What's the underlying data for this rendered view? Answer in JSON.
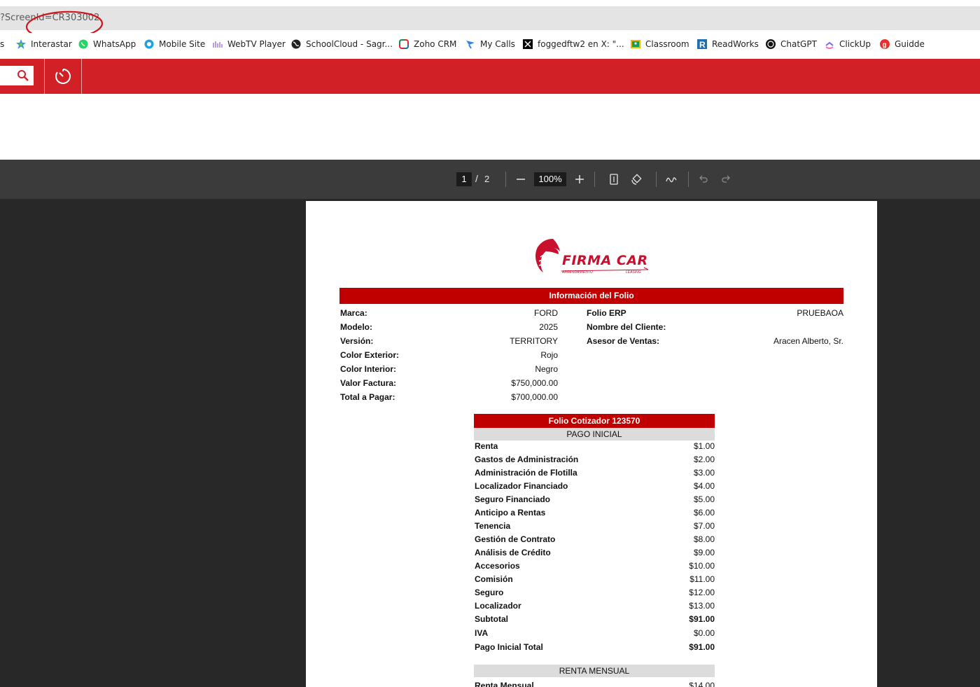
{
  "browser": {
    "address_text": "?ScreenId=CR303002",
    "bookmarks": [
      {
        "label": "s",
        "icon": "bookmark-icon"
      },
      {
        "label": "Interastar",
        "icon": "star-icon"
      },
      {
        "label": "WhatsApp",
        "icon": "whatsapp-icon"
      },
      {
        "label": "Mobile Site",
        "icon": "mobile-site-icon"
      },
      {
        "label": "WebTV Player",
        "icon": "webtv-icon"
      },
      {
        "label": "SchoolCloud - Sagr...",
        "icon": "globe-icon"
      },
      {
        "label": "Zoho CRM",
        "icon": "zoho-icon"
      },
      {
        "label": "My Calls",
        "icon": "calls-icon"
      },
      {
        "label": "foggedftw2 en X: \"...",
        "icon": "x-icon"
      },
      {
        "label": "Classroom",
        "icon": "classroom-icon"
      },
      {
        "label": "ReadWorks",
        "icon": "readworks-icon"
      },
      {
        "label": "ChatGPT",
        "icon": "chatgpt-icon"
      },
      {
        "label": "ClickUp",
        "icon": "clickup-icon"
      },
      {
        "label": "Guidde",
        "icon": "guidde-icon"
      }
    ]
  },
  "app_header": {
    "color": "#d22027",
    "search_icon": "search-icon",
    "timer_icon": "timer-icon"
  },
  "viewer": {
    "current_page": "1",
    "separator": "/",
    "total_pages": "2",
    "zoom": "100%"
  },
  "document": {
    "logo": {
      "name": "FIRMA CAR",
      "sub_left": "ARRENDAMIENTO",
      "sub_right": "LEASING"
    },
    "info_header": "Información del Folio",
    "left_fields": [
      {
        "label": "Marca:",
        "value": "FORD"
      },
      {
        "label": "Modelo:",
        "value": "2025"
      },
      {
        "label": "Versión:",
        "value": "TERRITORY"
      },
      {
        "label": "Color Exterior:",
        "value": "Rojo"
      },
      {
        "label": "Color Interior:",
        "value": "Negro"
      },
      {
        "label": "Valor Factura:",
        "value": "$750,000.00"
      },
      {
        "label": "Total a Pagar:",
        "value": "$700,000.00"
      }
    ],
    "right_fields": [
      {
        "label": "Folio ERP",
        "value": "PRUEBAOA"
      },
      {
        "label": "Nombre del Cliente:",
        "value": ""
      },
      {
        "label": "Asesor de Ventas:",
        "value": "Aracen Alberto, Sr."
      }
    ],
    "folio_header": "Folio Cotizador 123570",
    "pago_inicial_header": "PAGO INICIAL",
    "pago_rows": [
      {
        "label": "Renta",
        "value": "$1.00",
        "bold": false
      },
      {
        "label": "Gastos de Administración",
        "value": "$2.00",
        "bold": false
      },
      {
        "label": "Administración de Flotilla",
        "value": "$3.00",
        "bold": false
      },
      {
        "label": "Localizador Financiado",
        "value": "$4.00",
        "bold": false
      },
      {
        "label": "Seguro Financiado",
        "value": "$5.00",
        "bold": false
      },
      {
        "label": "Anticipo a Rentas",
        "value": "$6.00",
        "bold": false
      },
      {
        "label": "Tenencia",
        "value": "$7.00",
        "bold": false
      },
      {
        "label": "Gestión de Contrato",
        "value": "$8.00",
        "bold": false
      },
      {
        "label": "Análisis de Crédito",
        "value": "$9.00",
        "bold": false
      },
      {
        "label": "Accesorios",
        "value": "$10.00",
        "bold": false
      },
      {
        "label": "Comisión",
        "value": "$11.00",
        "bold": false
      },
      {
        "label": "Seguro",
        "value": "$12.00",
        "bold": false
      },
      {
        "label": "Localizador",
        "value": "$13.00",
        "bold": false
      },
      {
        "label": "Subtotal",
        "value": "$91.00",
        "bold": true
      },
      {
        "label": "IVA",
        "value": "$0.00",
        "bold": false
      },
      {
        "label": "Pago Inicial Total",
        "value": "$91.00",
        "bold": true
      }
    ],
    "renta_mensual_header": "RENTA MENSUAL",
    "renta_rows": [
      {
        "label": "Renta Mensual",
        "value": "$14.00",
        "bold": false
      }
    ]
  }
}
